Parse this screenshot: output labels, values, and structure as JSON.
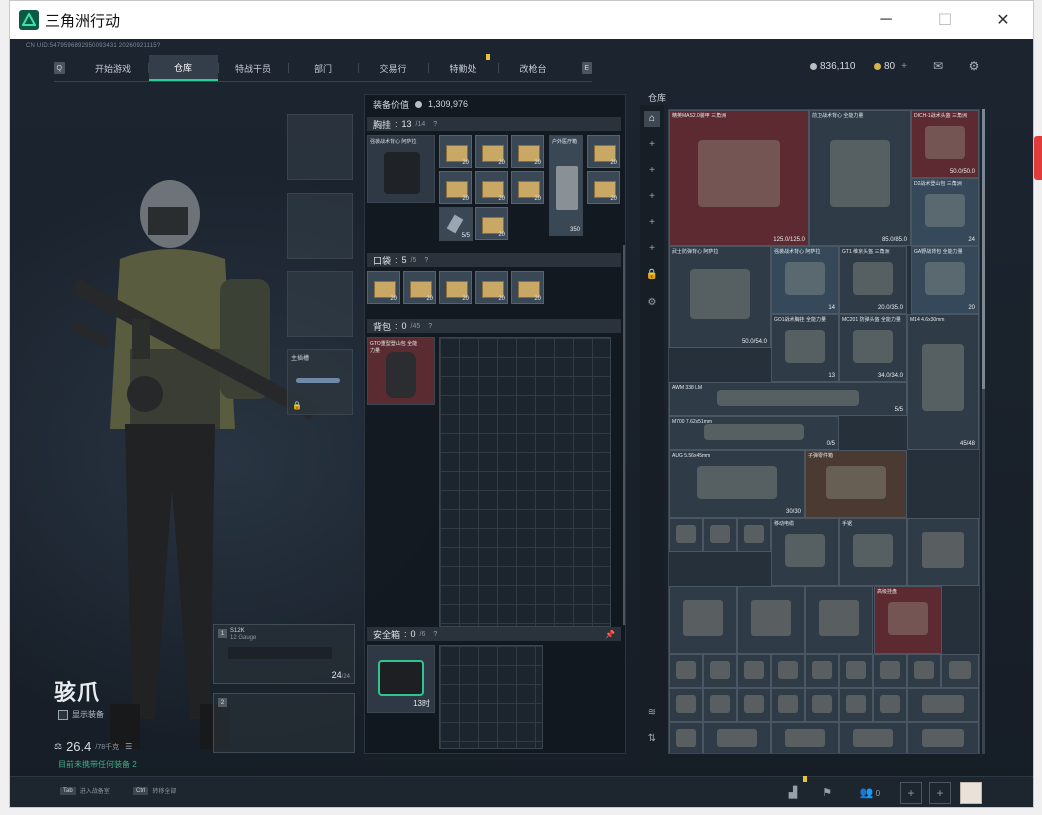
{
  "window": {
    "title": "三角洲行动"
  },
  "uid_text": "CN UID:5479596892950093431 20260921115?",
  "nav": {
    "left_key": "Q",
    "right_key": "E",
    "tabs": [
      "开始游戏",
      "仓库",
      "特战干员",
      "部门",
      "交易行",
      "特勤处",
      "改枪台"
    ],
    "active": "仓库"
  },
  "currency": {
    "silver": "836,110",
    "gold": "80",
    "gold_plus": "+"
  },
  "operator": {
    "name": "骇爪",
    "show_gear_label": "显示装备",
    "weight": "26.4",
    "weight_max": "/78千克",
    "hint": "目前未携带任何装备   2"
  },
  "gear_slots": {
    "secondary_label": "主插槽"
  },
  "weapons": [
    {
      "num": "1",
      "name": "S12K",
      "sub": "12 Gauge",
      "ammo": "24",
      "ammo_max": "/24"
    },
    {
      "num": "2",
      "name": "",
      "sub": "",
      "ammo": "",
      "ammo_max": ""
    }
  ],
  "equipment": {
    "value_label": "装备价值",
    "value": "1,309,976",
    "chest_label": "胸挂",
    "chest_cap": "13",
    "chest_cap_max": "/14",
    "chest_item_name": "强袭战术背心 阿萨拉",
    "pocket_label": "口袋",
    "pocket_cap": "5",
    "pocket_cap_max": "/5",
    "backpack_label": "背包",
    "backpack_cap": "0",
    "backpack_cap_max": "/45",
    "backpack_item_name": "GTO重型登山包 全能力量",
    "safebox_label": "安全箱",
    "safebox_cap": "0",
    "safebox_cap_max": "/6",
    "safebox_timer": "13时",
    "chest_counts": [
      "20",
      "20",
      "20",
      "20",
      "20",
      "20",
      "20",
      "20",
      "20"
    ],
    "med_label": "户外医疗箱",
    "med_count": "350",
    "injector_count": "5/5",
    "pocket_counts": [
      "20",
      "20",
      "20",
      "20",
      "20"
    ]
  },
  "warehouse": {
    "label": "仓库",
    "items": [
      {
        "name": "精英MAS2.0装甲 三角洲",
        "val": "125.0/125.0"
      },
      {
        "name": "前卫战术背心 全能力量",
        "val": "85.0/85.0"
      },
      {
        "name": "DICH-1战术头盔 三角洲",
        "val": "50.0/50.0"
      },
      {
        "name": "D2战术登山包 三角洲",
        "val": "24"
      },
      {
        "name": "武士防弹背心 阿萨拉",
        "val": "50.0/54.0"
      },
      {
        "name": "强袭战术背心 阿萨拉",
        "val": "14"
      },
      {
        "name": "GT1 维京头盔 三角洲",
        "val": "20.0/35.0"
      },
      {
        "name": "GA野战背包 全能力量",
        "val": "20"
      },
      {
        "name": "GO1战术胸挂 全能力量",
        "val": "13"
      },
      {
        "name": "MC201 防弹头盔 全能力量",
        "val": "34.0/34.0"
      },
      {
        "name": "M14 4.6x30mm",
        "val": "45/48"
      },
      {
        "name": "AWM 338 LM",
        "val": "5/5"
      },
      {
        "name": "M700 7.62x51mm",
        "val": "0/5"
      },
      {
        "name": "AUG 5.56x45mm",
        "val": "30/30"
      },
      {
        "name": "子弹零件箱",
        "val": ""
      },
      {
        "name": "移动电缆",
        "val": ""
      },
      {
        "name": "手锯",
        "val": ""
      },
      {
        "name": "高级挂盘",
        "val": ""
      }
    ]
  },
  "bottom": {
    "tab_key": "Tab",
    "tab_label": "进入战备室",
    "ctrl_key": "Ctrl",
    "ctrl_label": "转移全部",
    "friends": "0"
  }
}
